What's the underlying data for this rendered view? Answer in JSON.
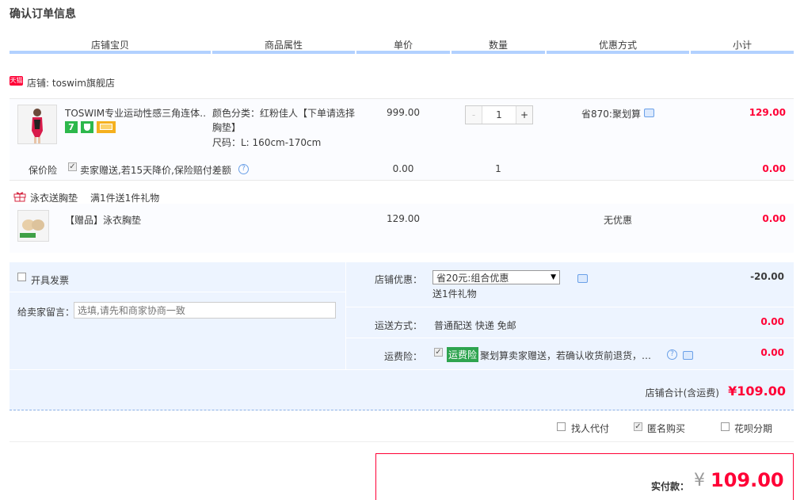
{
  "page_title": "确认订单信息",
  "columns": [
    "店铺宝贝",
    "商品属性",
    "单价",
    "数量",
    "优惠方式",
    "小计"
  ],
  "store": {
    "badge": "天猫",
    "label": "店铺: toswim旗舰店"
  },
  "item": {
    "name": "TOSWIM专业运动性感三角连体…",
    "attr_color": "颜色分类：红粉佳人【下单请选择胸垫】",
    "attr_size": "尺码：L: 160cm-170cm",
    "price": "999.00",
    "quantity": "1",
    "minus": "-",
    "plus": "+",
    "discount": "省870:聚划算",
    "subtotal": "129.00"
  },
  "insurance": {
    "label": "保价险",
    "text": "卖家赠送,若15天降价,保险赔付差额",
    "price": "0.00",
    "qty": "1",
    "subtotal": "0.00"
  },
  "gift_promo": {
    "title": "泳衣送胸垫",
    "desc": "满1件送1件礼物"
  },
  "gift": {
    "name": "【赠品】泳衣胸垫",
    "price": "129.00",
    "discount": "无优惠",
    "subtotal": "0.00"
  },
  "invoice_label": "开具发票",
  "message": {
    "label": "给卖家留言：",
    "placeholder": "选填,请先和商家协商一致"
  },
  "shop_discount": {
    "label": "店铺优惠：",
    "selected": "省20元:组合优惠",
    "note": "送1件礼物",
    "amount": "-20.00"
  },
  "shipping": {
    "label": "运送方式：",
    "value": "普通配送 快递 免邮",
    "amount": "0.00"
  },
  "freight_ins": {
    "label": "运费险：",
    "tag": "运费险",
    "text": "聚划算卖家赠送，若确认收货前退货，…",
    "amount": "0.00"
  },
  "shop_total": {
    "label": "店铺合计(含运费)",
    "amount": "¥109.00"
  },
  "options": {
    "pay_for_me": "找人代付",
    "anonymous": "匿名购买",
    "huabei": "花呗分期"
  },
  "final": {
    "label": "实付款：",
    "currency": "¥",
    "amount": "109.00"
  },
  "colors": {
    "accent_red": "#ff0036",
    "header_line": "#b2d1ff",
    "blue_bg": "#edf4ff",
    "green_tag": "#2ea44f"
  }
}
